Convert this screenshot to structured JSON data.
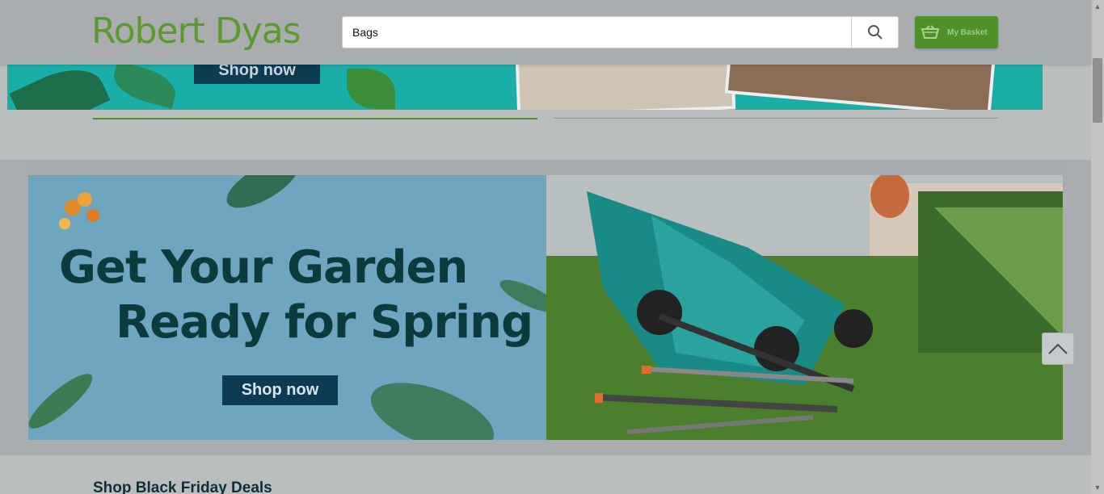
{
  "header": {
    "logo_text": "Robert Dyas",
    "search_value": "Bags",
    "search_icon": "search-icon",
    "basket_label": "My Basket",
    "basket_icon": "basket-icon"
  },
  "banner_top": {
    "cta_label": "Shop now"
  },
  "hero": {
    "title_line1": "Get Your Garden",
    "title_line2": "Ready for Spring",
    "cta_label": "Shop now"
  },
  "section": {
    "title": "Shop Black Friday Deals"
  },
  "colors": {
    "brand_green": "#4f9128",
    "cta_navy": "#0d3b52",
    "hero_title": "#0c3b3b"
  },
  "icons": {
    "scroll_top": "chevron-up-icon"
  }
}
